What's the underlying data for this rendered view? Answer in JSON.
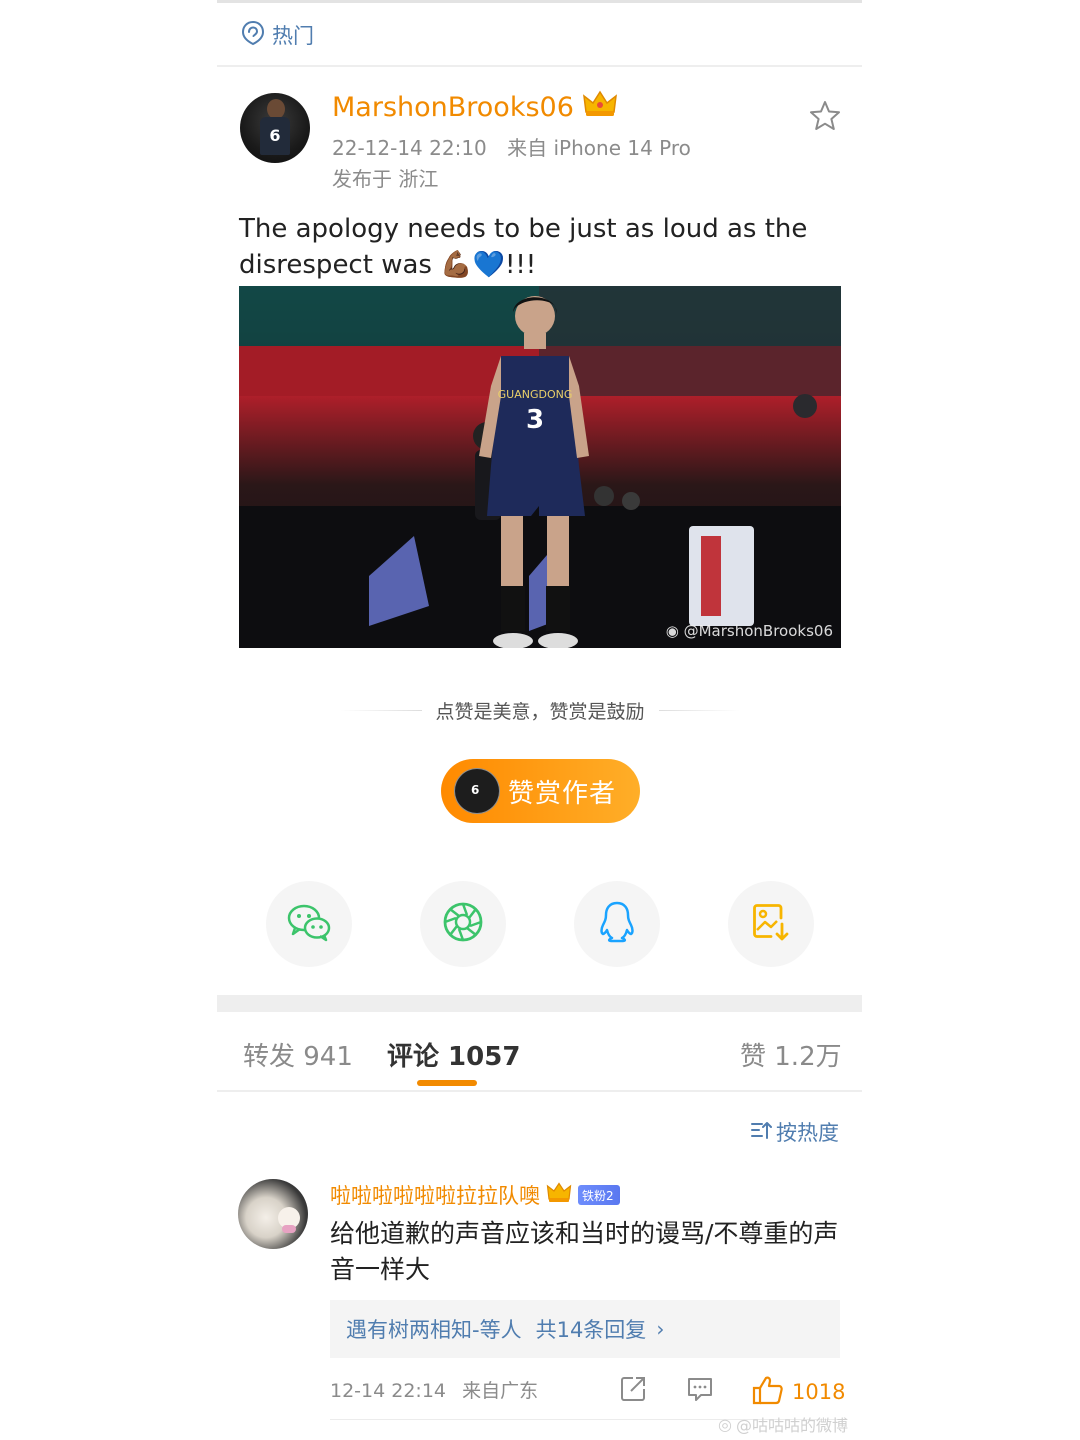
{
  "header": {
    "hot_label": "热门"
  },
  "post": {
    "username": "MarshonBrooks06",
    "datetime": "22-12-14 22:10",
    "source": "来自 iPhone 14 Pro",
    "location": "发布于 浙江",
    "text": "The apology needs to be just as loud as the disrespect was 💪🏾💙!!!",
    "image": {
      "watermark": "@MarshonBrooks06",
      "jersey_team": "GUANGDONG",
      "jersey_number": "3"
    }
  },
  "reward": {
    "slogan": "点赞是美意，赞赏是鼓励",
    "button_label": "赞赏作者"
  },
  "share": {
    "items": [
      "wechat-icon",
      "moments-icon",
      "qq-icon",
      "save-image-icon"
    ],
    "colors": {
      "wechat": "#3cc46b",
      "moments": "#3cc46b",
      "qq": "#1aa3ff",
      "save": "#f7b500"
    }
  },
  "tabs": {
    "repost": "转发 941",
    "comments": "评论 1057",
    "likes": "赞 1.2万"
  },
  "sort": {
    "label": "按热度"
  },
  "comment": {
    "username": "啦啦啦啦啦啦拉拉队噢",
    "badge": "铁粉2",
    "text": "给他道歉的声音应该和当时的谩骂/不尊重的声音一样大",
    "reply_users": "遇有树两相知-等人",
    "reply_count": "共14条回复",
    "datetime": "12-14 22:14",
    "source": "来自广东",
    "like_count": "1018"
  },
  "footer": {
    "watermark": "@咕咕咕的微博"
  },
  "colors": {
    "accent": "#f18a00",
    "link": "#507daf",
    "background": "#ffffff"
  }
}
